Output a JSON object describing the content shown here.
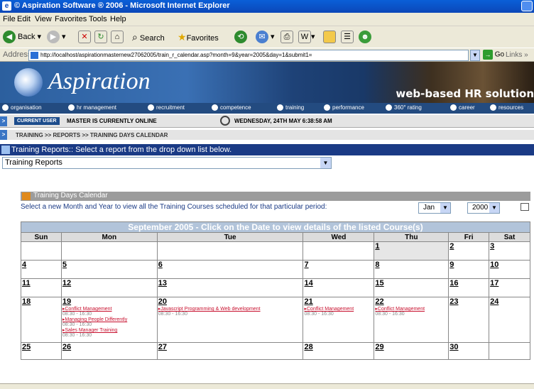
{
  "window": {
    "title": "© Aspiration Software ® 2006 - Microsoft Internet Explorer"
  },
  "menu": [
    "File",
    "Edit",
    "View",
    "Favorites",
    "Tools",
    "Help"
  ],
  "toolbar": {
    "back": "Back",
    "search": "Search",
    "favorites": "Favorites"
  },
  "address": {
    "label": "Address",
    "url": "http://localhost/aspirationmasternew27062005/train_r_calendar.asp?month=9&year=2005&day=1&submit1=",
    "go": "Go",
    "links": "Links"
  },
  "banner": {
    "logo": "Aspiration",
    "tagline": "web-based HR solution"
  },
  "nav": [
    "organisation",
    "hr management",
    "recruitment",
    "competence",
    "training",
    "performance",
    "360° rating",
    "career",
    "resources"
  ],
  "user": {
    "badge": "CURRENT USER",
    "status": "MASTER IS CURRENTLY ONLINE",
    "datetime": "WEDNESDAY, 24TH MAY 6:38:58 AM"
  },
  "breadcrumb": "TRAINING >> REPORTS >> TRAINING DAYS CALENDAR",
  "reports": {
    "heading": "Training Reports:: Select a report from the drop down list below.",
    "selected": "Training Reports"
  },
  "calendar": {
    "section_title": "Training Days Calendar",
    "instruction": "Select a new Month and Year to view all the Training Courses scheduled for that particular period:",
    "month_select": "Jan",
    "year_select": "2000",
    "header": "September 2005 - Click on the Date to view details of the listed Course(s)",
    "days": [
      "Sun",
      "Mon",
      "Tue",
      "Wed",
      "Thu",
      "Fri",
      "Sat"
    ],
    "weeks": [
      [
        {
          "d": ""
        },
        {
          "d": ""
        },
        {
          "d": ""
        },
        {
          "d": ""
        },
        {
          "d": "1"
        },
        {
          "d": "2"
        },
        {
          "d": "3"
        }
      ],
      [
        {
          "d": "4"
        },
        {
          "d": "5"
        },
        {
          "d": "6"
        },
        {
          "d": "7"
        },
        {
          "d": "8"
        },
        {
          "d": "9"
        },
        {
          "d": "10"
        }
      ],
      [
        {
          "d": "11"
        },
        {
          "d": "12"
        },
        {
          "d": "13"
        },
        {
          "d": "14"
        },
        {
          "d": "15"
        },
        {
          "d": "16"
        },
        {
          "d": "17"
        }
      ],
      [
        {
          "d": "18"
        },
        {
          "d": "19",
          "events": [
            {
              "name": "Conflict Management",
              "time": "08:30 - 16:30"
            },
            {
              "name": "Managing People Differently",
              "time": "08:30 - 16:30"
            },
            {
              "name": "Sales Manager Training",
              "time": "08:30 - 16:30"
            }
          ]
        },
        {
          "d": "20",
          "events": [
            {
              "name": "Javascript Programming & Web development",
              "time": "08:30 - 16:30"
            }
          ]
        },
        {
          "d": "21",
          "events": [
            {
              "name": "Conflict Management",
              "time": "08:30 - 16:30"
            }
          ]
        },
        {
          "d": "22",
          "events": [
            {
              "name": "Conflict Management",
              "time": "08:30 - 16:30"
            }
          ]
        },
        {
          "d": "23"
        },
        {
          "d": "24"
        }
      ],
      [
        {
          "d": "25"
        },
        {
          "d": "26"
        },
        {
          "d": "27"
        },
        {
          "d": "28"
        },
        {
          "d": "29"
        },
        {
          "d": "30"
        },
        {
          "d": ""
        }
      ]
    ]
  }
}
